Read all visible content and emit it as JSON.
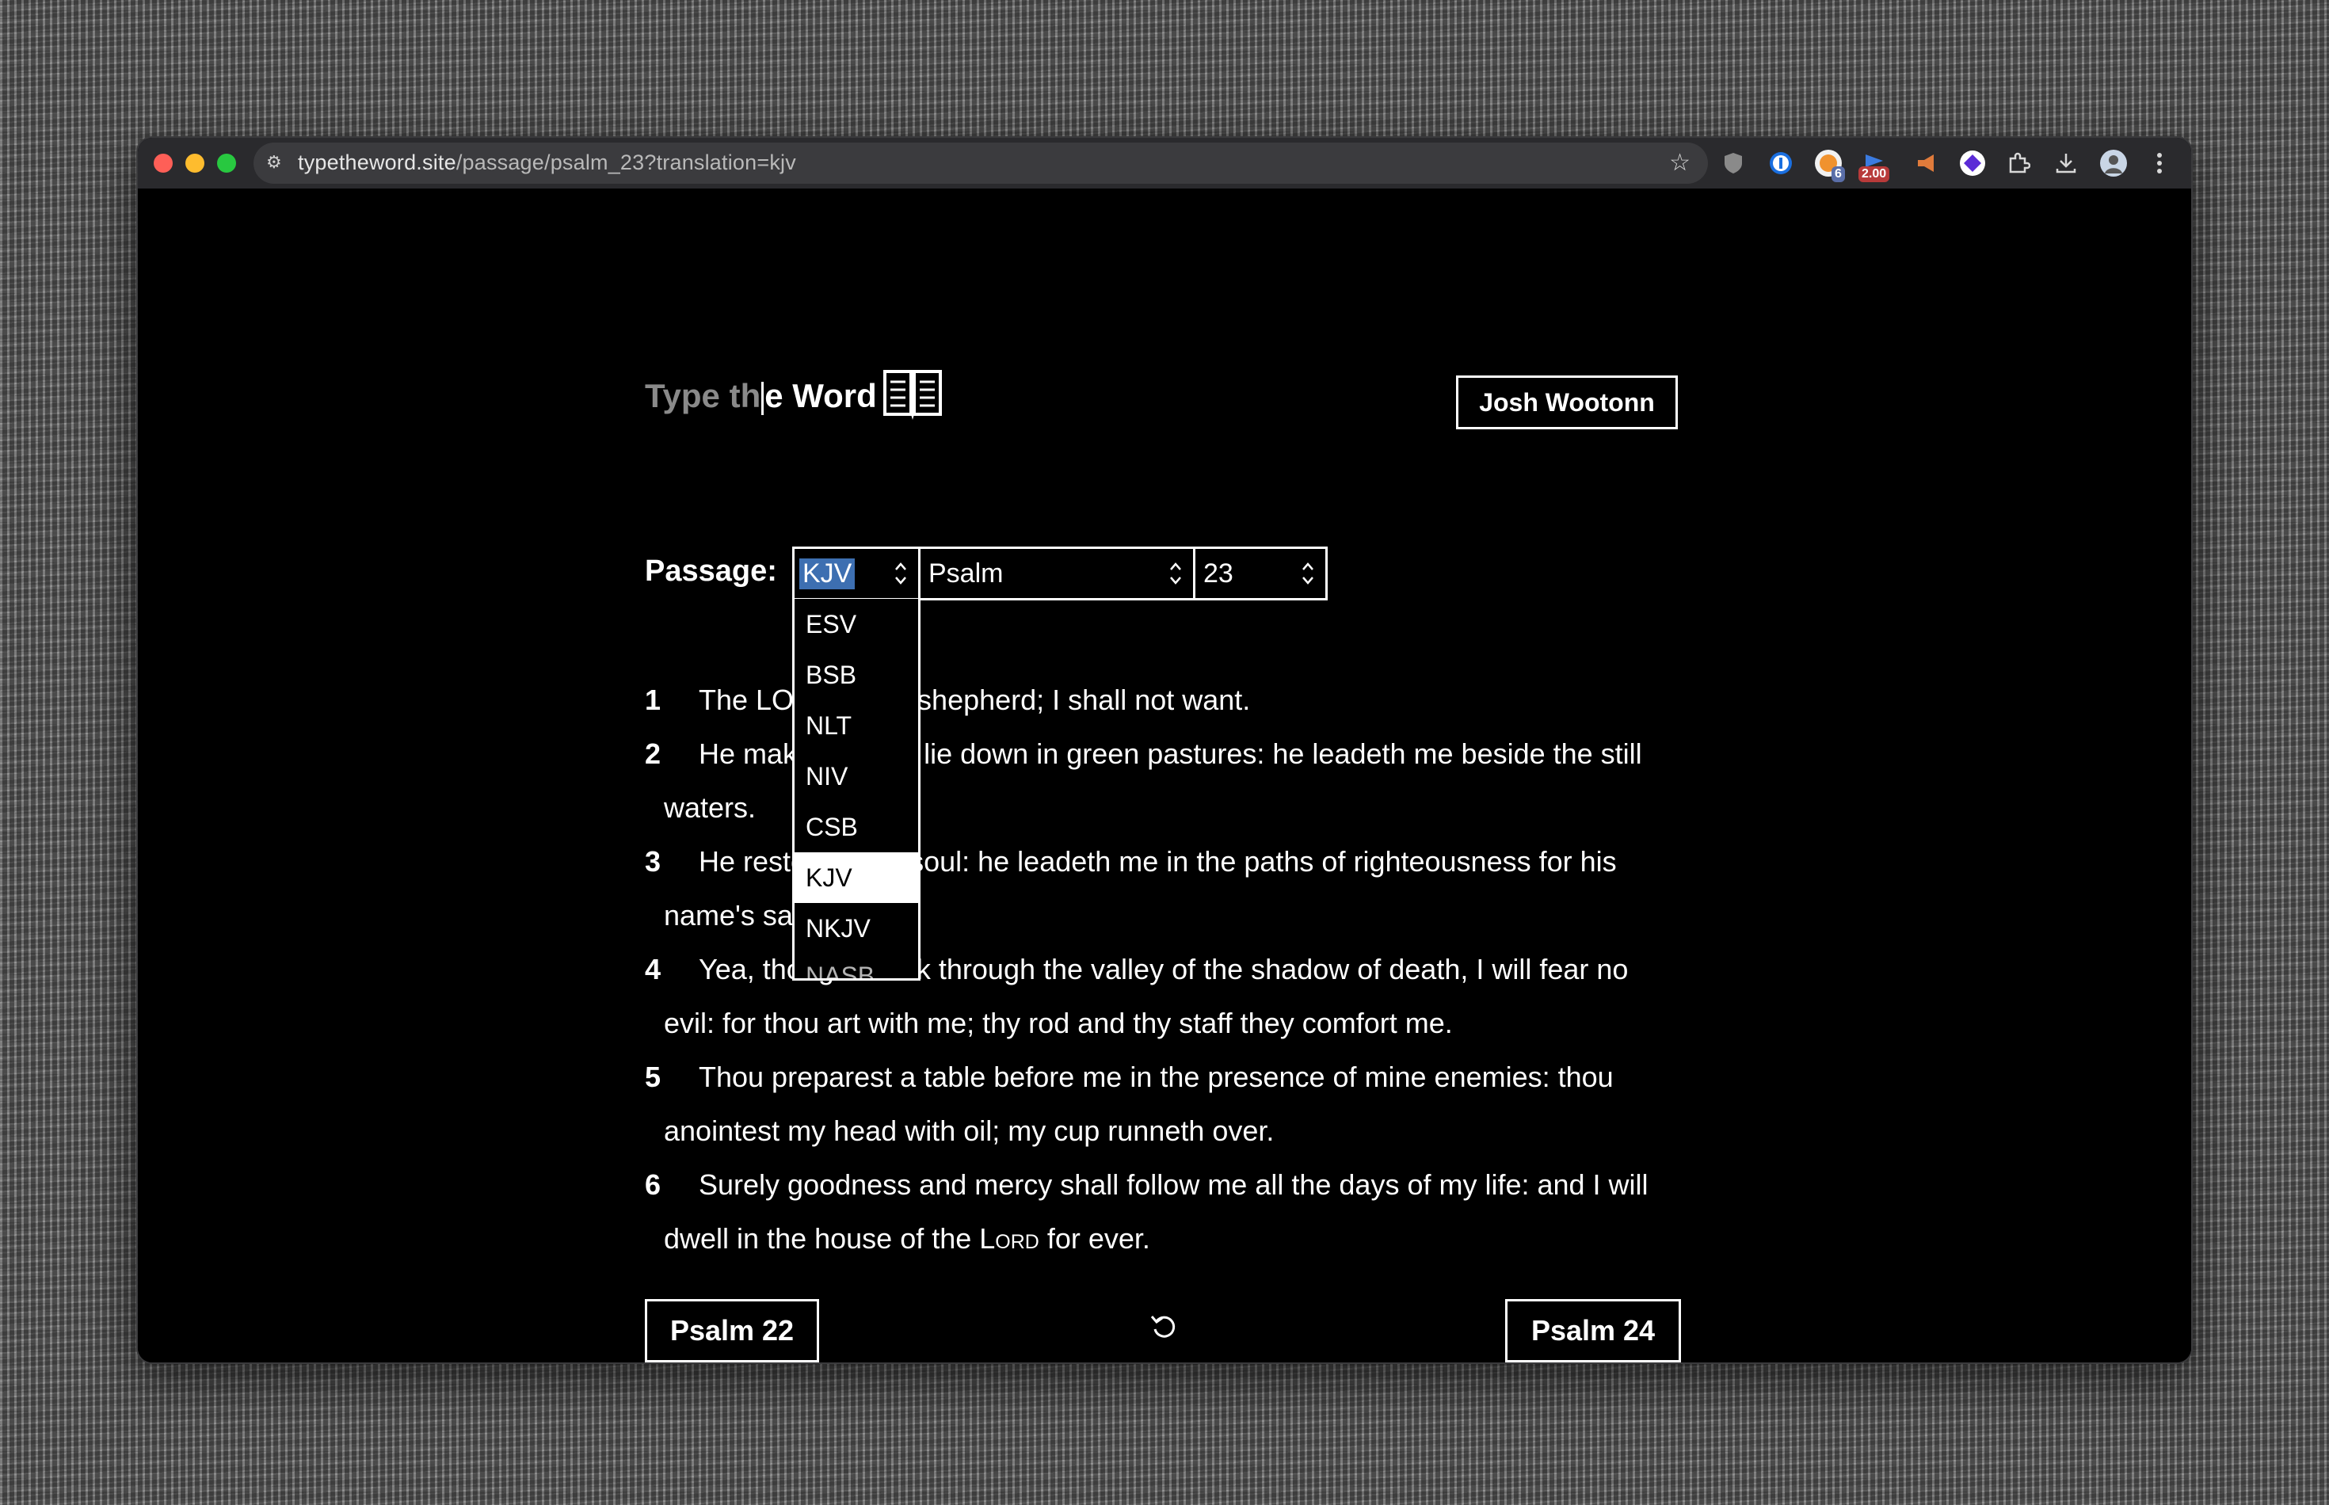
{
  "browser": {
    "url_host": "typetheword.site",
    "url_path": "/passage/psalm_23?translation=kjv",
    "extension_badges": {
      "badge_a": "6",
      "badge_b": "2.00"
    }
  },
  "header": {
    "logo_typed": "Type th",
    "logo_remaining": "e Word",
    "user_button": "Josh Wootonn"
  },
  "passage": {
    "label": "Passage:",
    "translation": "KJV",
    "book": "Psalm",
    "chapter": "23",
    "translation_options": [
      "ESV",
      "BSB",
      "NLT",
      "NIV",
      "CSB",
      "KJV",
      "NKJV",
      "NASB"
    ]
  },
  "verses": [
    {
      "num": "1",
      "pre": "The LORD is my shepherd; I shall not want.",
      "lord": "",
      "post": ""
    },
    {
      "num": "2",
      "pre": "He maketh me to lie down in green pastures: he leadeth me beside the still waters.",
      "lord": "",
      "post": ""
    },
    {
      "num": "3",
      "pre": "He restoreth my soul: he leadeth me in the paths of righteousness for his name's sake.",
      "lord": "",
      "post": ""
    },
    {
      "num": "4",
      "pre": "Yea, though I walk through the valley of the shadow of death, I will fear no evil: for thou art with me; thy rod and thy staff they comfort me.",
      "lord": "",
      "post": ""
    },
    {
      "num": "5",
      "pre": "Thou preparest a table before me in the presence of mine enemies: thou anointest my head with oil; my cup runneth over.",
      "lord": "",
      "post": ""
    },
    {
      "num": "6",
      "pre": "Surely goodness and mercy shall follow me all the days of my life: and I will dwell in the house of the ",
      "lord": "Lord",
      "post": " for ever."
    }
  ],
  "nav": {
    "prev": "Psalm 22",
    "next": "Psalm 24"
  },
  "help": "?"
}
